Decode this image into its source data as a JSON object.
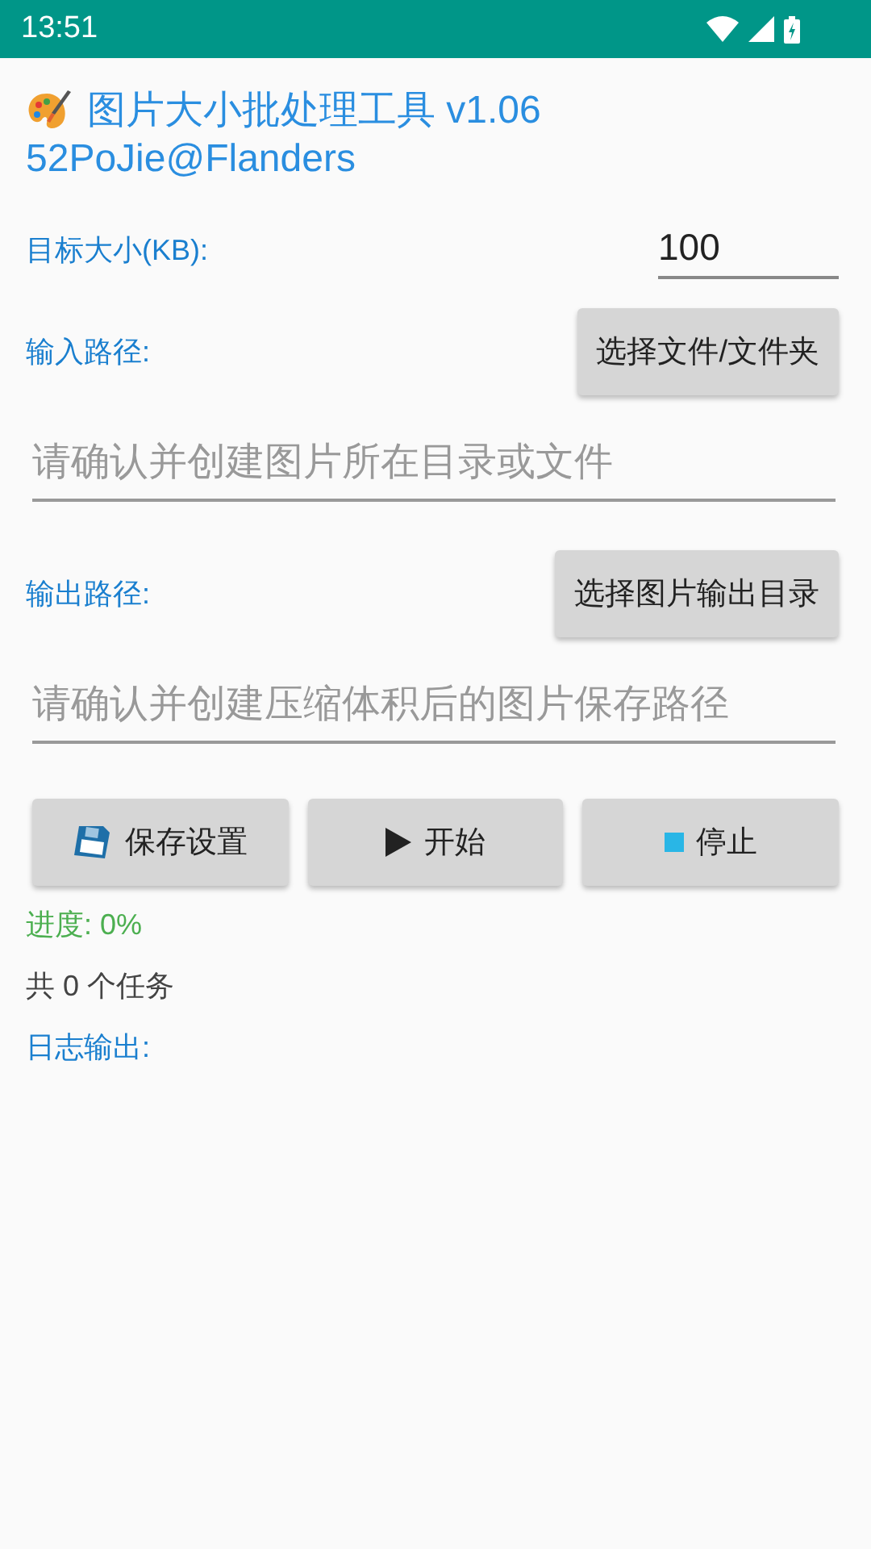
{
  "status_bar": {
    "time": "13:51"
  },
  "header": {
    "title": "图片大小批处理工具 v1.06",
    "author": "52PoJie@Flanders"
  },
  "target_size": {
    "label": "目标大小(KB):",
    "value": "100"
  },
  "input_path": {
    "label": "输入路径:",
    "button": "选择文件/文件夹",
    "placeholder": "请确认并创建图片所在目录或文件"
  },
  "output_path": {
    "label": "输出路径:",
    "button": "选择图片输出目录",
    "placeholder": "请确认并创建压缩体积后的图片保存路径"
  },
  "actions": [
    {
      "kind": "save",
      "label": "保存设置"
    },
    {
      "kind": "start",
      "label": "开始"
    },
    {
      "kind": "stop",
      "label": "停止"
    }
  ],
  "progress": "进度: 0%",
  "task_count": "共 0 个任务",
  "log_label": "日志输出:"
}
